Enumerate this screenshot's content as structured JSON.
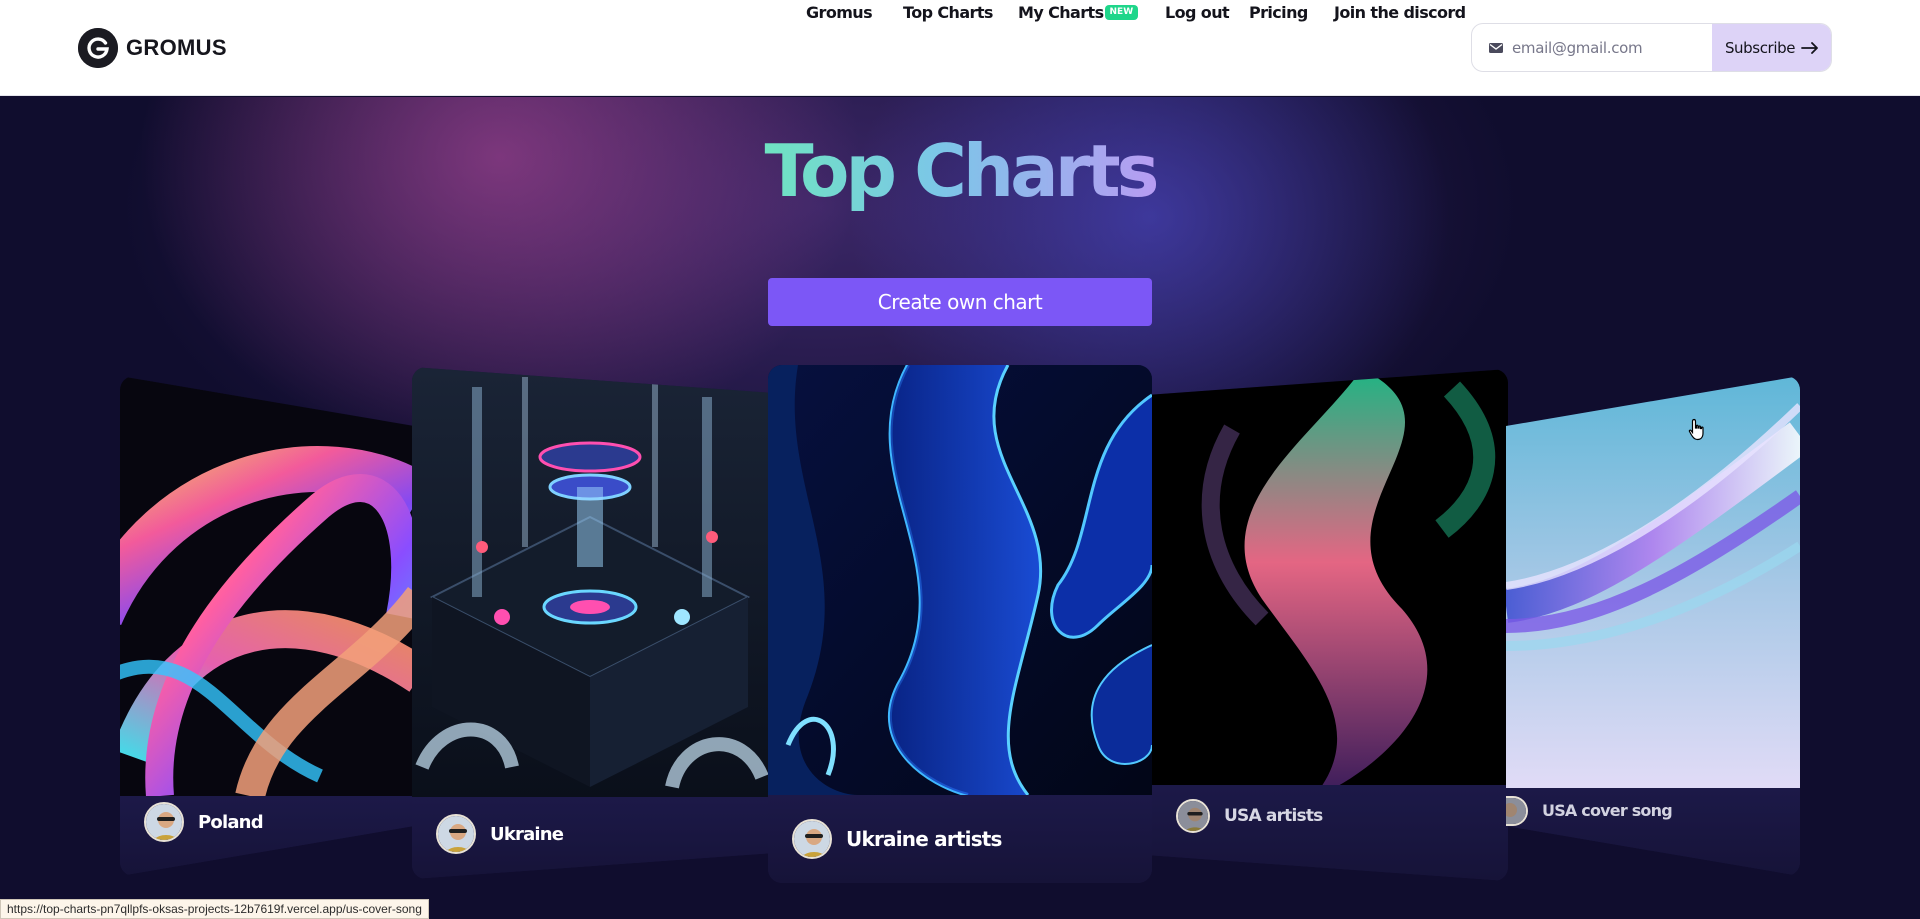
{
  "header": {
    "logo_text": "GROMUS",
    "nav": [
      {
        "label": "Gromus"
      },
      {
        "label": "Top Charts"
      },
      {
        "label": "My Charts",
        "badge": "NEW"
      },
      {
        "label": "Log out"
      },
      {
        "label": "Pricing"
      },
      {
        "label": "Join the discord"
      }
    ],
    "subscribe": {
      "placeholder": "email@gmail.com",
      "button_label": "Subscribe",
      "icons": [
        "mail-icon",
        "arrow-right-icon"
      ]
    }
  },
  "hero": {
    "title": "Top Charts",
    "create_button": "Create own chart"
  },
  "cards": [
    {
      "label": "Poland",
      "art": "rainbow-swirl"
    },
    {
      "label": "Ukraine",
      "art": "glass-machine"
    },
    {
      "label": "Ukraine artists",
      "art": "blue-waves"
    },
    {
      "label": "USA artists",
      "art": "aurora-flame"
    },
    {
      "label": "USA cover song",
      "art": "pastel-ribbons"
    }
  ],
  "status_bar": {
    "url": "https://top-charts-pn7qllpfs-oksas-projects-12b7619f.vercel.app/us-cover-song"
  },
  "colors": {
    "accent": "#7c57f6",
    "badge": "#1fd68a",
    "background": "#100d2e",
    "subscribe_button": "#ddd3f7"
  }
}
